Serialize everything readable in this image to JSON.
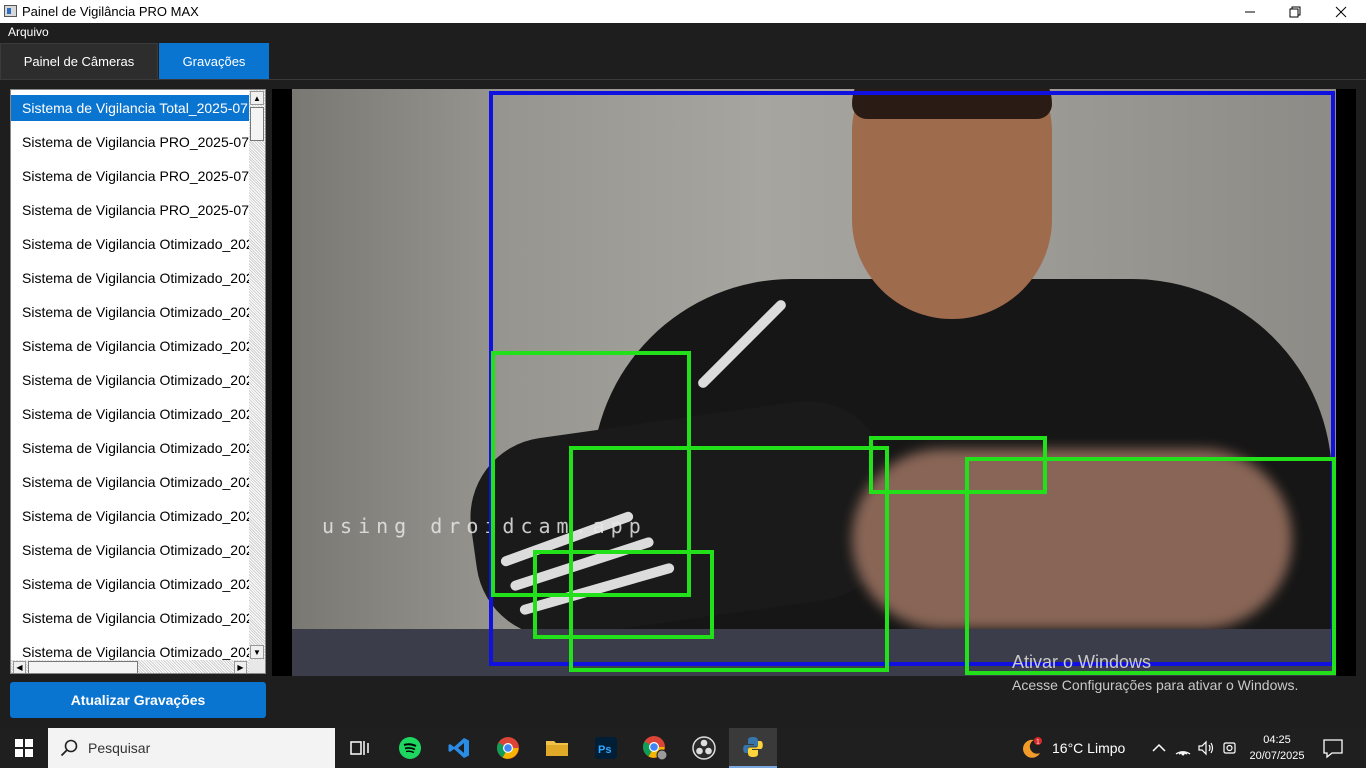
{
  "window": {
    "title": "Painel de Vigilância PRO MAX"
  },
  "menu": {
    "file": "Arquivo"
  },
  "tabs": {
    "cameras": "Painel de Câmeras",
    "recordings": "Gravações"
  },
  "recordings": {
    "items": [
      "Sistema de Vigilancia Total_2025-07",
      "Sistema de Vigilancia PRO_2025-07",
      "Sistema de Vigilancia PRO_2025-07",
      "Sistema de Vigilancia PRO_2025-07",
      "Sistema de Vigilancia Otimizado_202",
      "Sistema de Vigilancia Otimizado_202",
      "Sistema de Vigilancia Otimizado_202",
      "Sistema de Vigilancia Otimizado_202",
      "Sistema de Vigilancia Otimizado_202",
      "Sistema de Vigilancia Otimizado_202",
      "Sistema de Vigilancia Otimizado_202",
      "Sistema de Vigilancia Otimizado_202",
      "Sistema de Vigilancia Otimizado_202",
      "Sistema de Vigilancia Otimizado_202",
      "Sistema de Vigilancia Otimizado_202",
      "Sistema de Vigilancia Otimizado_202",
      "Sistema de Vigilancia Otimizado_202"
    ],
    "selected_index": 0,
    "refresh_button": "Atualizar Gravações"
  },
  "video": {
    "overlay_text": "using droidcam.app"
  },
  "activation": {
    "title": "Ativar o Windows",
    "subtitle": "Acesse Configurações para ativar o Windows."
  },
  "taskbar": {
    "search_placeholder": "Pesquisar",
    "weather": "16°C  Limpo",
    "weather_badge": "1",
    "time": "04:25",
    "date": "20/07/2025"
  },
  "colors": {
    "accent": "#0a74d1",
    "detection_person": "#1010e0",
    "detection_motion": "#22e01a"
  }
}
